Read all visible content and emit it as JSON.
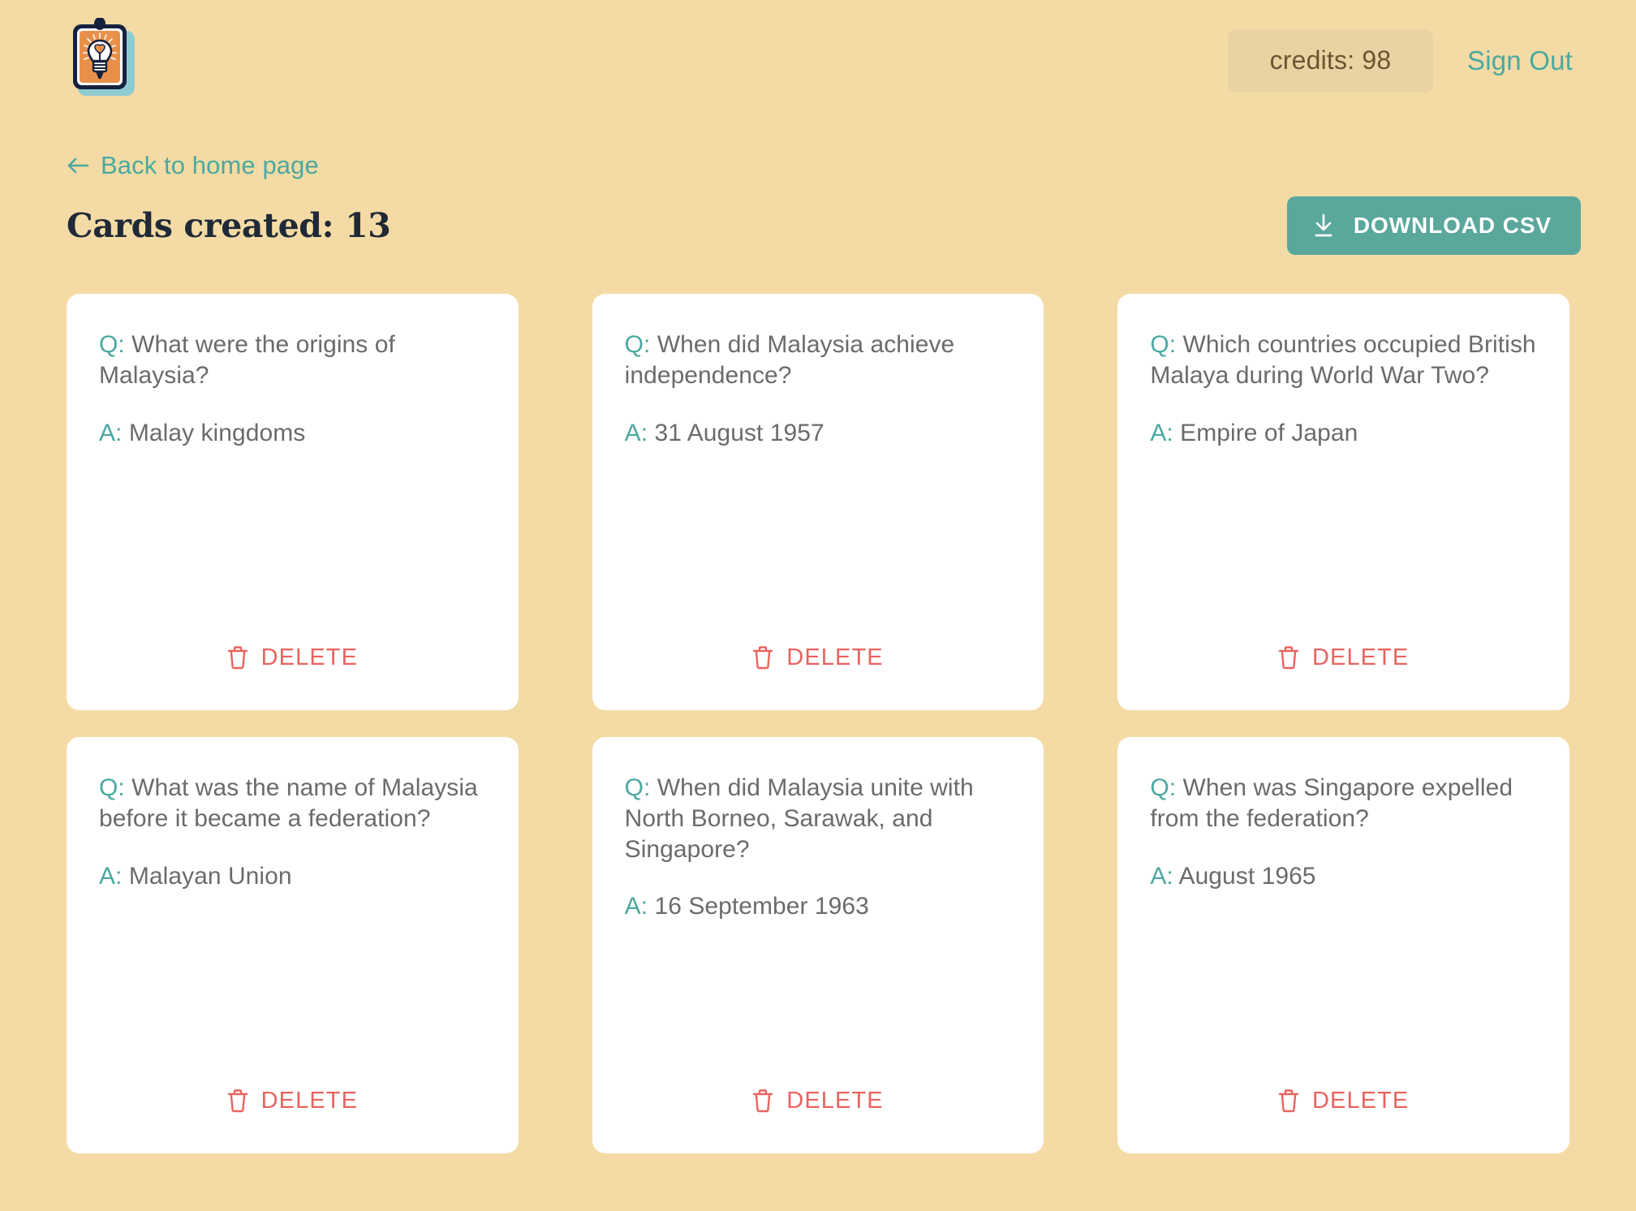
{
  "header": {
    "logo_icon": "lightbulb-card-logo",
    "credits_label": "credits: 98",
    "sign_out_label": "Sign Out"
  },
  "subheader": {
    "back_link_label": "Back to home page",
    "back_arrow_icon": "arrow-left-icon",
    "page_title": "Cards created: 13",
    "download_button_label": "DOWNLOAD CSV",
    "download_icon": "download-icon"
  },
  "card_defaults": {
    "q_prefix": "Q:",
    "a_prefix": "A:",
    "delete_label": "DELETE",
    "delete_icon": "trash-icon"
  },
  "colors": {
    "background": "#f4dba5",
    "accent_teal": "#4aa9a0",
    "button_teal": "#5aa79c",
    "credits_pill": "#e9d3a3",
    "credits_text": "#6b5634",
    "delete_red": "#e8645f",
    "card_white": "#ffffff",
    "title_dark": "#1f2937",
    "body_gray": "#6b6b6b"
  },
  "cards": [
    {
      "question": "What were the origins of Malaysia?",
      "answer": "Malay kingdoms"
    },
    {
      "question": "When did Malaysia achieve independence?",
      "answer": "31 August 1957"
    },
    {
      "question": "Which countries occupied British Malaya during World War Two?",
      "answer": "Empire of Japan"
    },
    {
      "question": "What was the name of Malaysia before it became a federation?",
      "answer": "Malayan Union"
    },
    {
      "question": "When did Malaysia unite with North Borneo, Sarawak, and Singapore?",
      "answer": "16 September 1963"
    },
    {
      "question": "When was Singapore expelled from the federation?",
      "answer": "August 1965"
    }
  ]
}
